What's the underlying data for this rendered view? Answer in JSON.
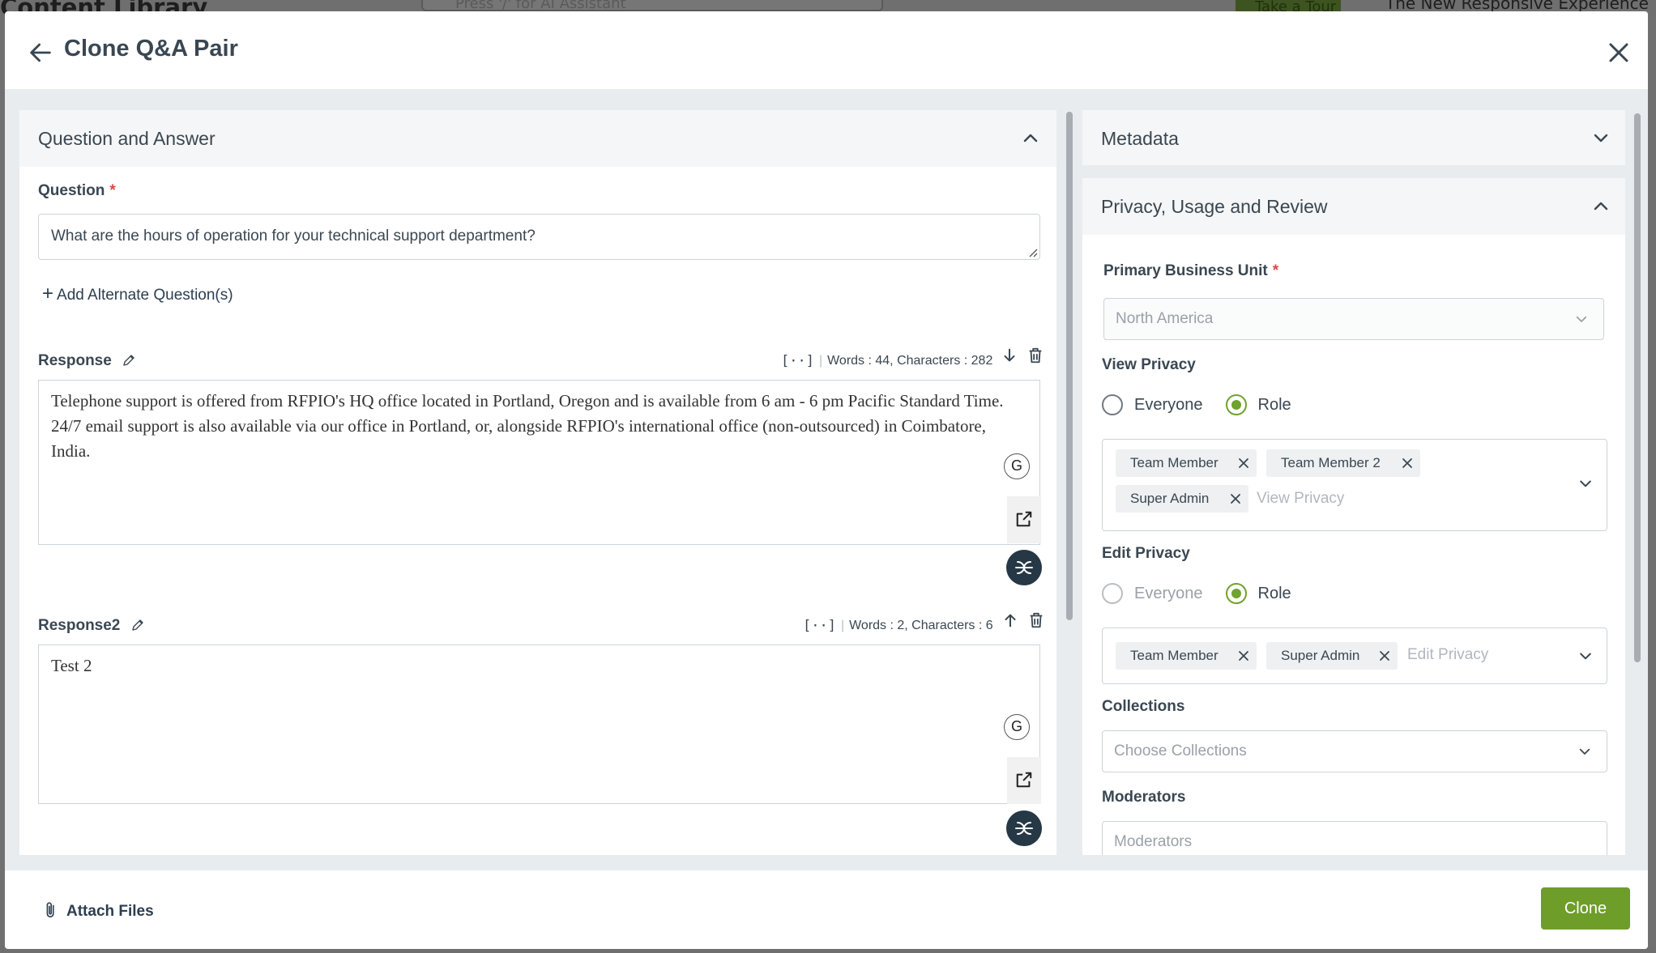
{
  "background": {
    "page_title": "Content Library",
    "search_placeholder": "Press '/' for AI Assistant",
    "tour_button": "Take a Tour",
    "news_text": "The New Responsive Experience"
  },
  "modal": {
    "title": "Clone Q&A Pair",
    "qa_section": {
      "title": "Question and Answer",
      "question_label": "Question",
      "required_mark": "*",
      "question_value": "What are the hours of operation for your technical support department?",
      "add_alternate": "Add Alternate Question(s)",
      "responses": [
        {
          "label": "Response",
          "stats": "Words : 44, Characters : 282",
          "text": "Telephone support is offered from RFPIO's HQ office located in Portland, Oregon and is available from 6 am - 6 pm Pacific Standard Time.\n24/7 email support is also available via our office in Portland, or, alongside RFPIO's international office (non-outsourced) in Coimbatore, India."
        },
        {
          "label": "Response2",
          "stats": "Words : 2, Characters : 6",
          "text": "Test 2"
        }
      ],
      "bracket_symbol": "[··]",
      "grammar_button": "G"
    },
    "metadata_section": {
      "title": "Metadata"
    },
    "privacy_section": {
      "title": "Privacy, Usage and Review",
      "primary_bu_label": "Primary Business Unit",
      "primary_bu_value": "North America",
      "view_privacy": {
        "label": "View Privacy",
        "options": [
          "Everyone",
          "Role"
        ],
        "selected": "Role",
        "tags": [
          "Team Member",
          "Team Member 2",
          "Super Admin"
        ],
        "placeholder": "View Privacy"
      },
      "edit_privacy": {
        "label": "Edit Privacy",
        "options": [
          "Everyone",
          "Role"
        ],
        "selected": "Role",
        "tags": [
          "Team Member",
          "Super Admin"
        ],
        "placeholder": "Edit Privacy"
      },
      "collections_label": "Collections",
      "collections_placeholder": "Choose Collections",
      "moderators_label": "Moderators",
      "moderators_placeholder": "Moderators"
    },
    "footer": {
      "attach_label": "Attach Files",
      "clone_label": "Clone"
    }
  },
  "colors": {
    "accent_green": "#6f9d2a",
    "radio_green": "#6fa22e",
    "required_red": "#e14545",
    "ai_button_dark": "#263745"
  },
  "icons": [
    "back-arrow-icon",
    "close-icon",
    "chevron-up-icon",
    "chevron-down-icon",
    "pencil-icon",
    "arrow-down-icon",
    "arrow-up-icon",
    "trash-icon",
    "external-link-icon",
    "ai-assist-icon",
    "paperclip-icon",
    "remove-tag-icon"
  ]
}
